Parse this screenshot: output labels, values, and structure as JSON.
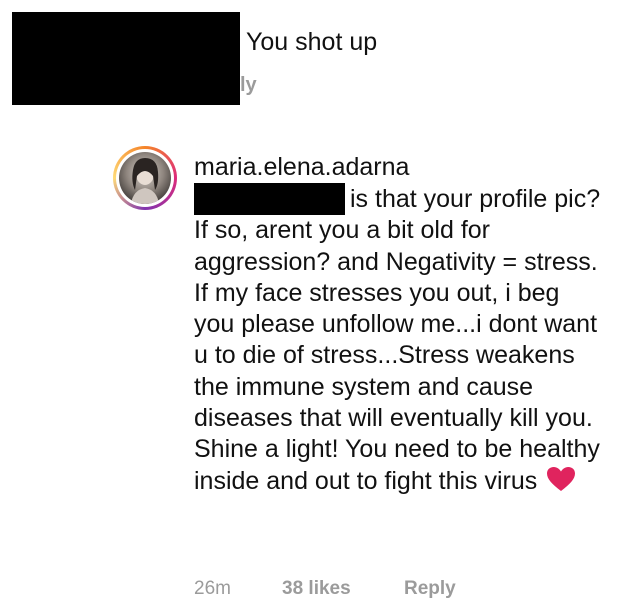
{
  "top_comment": {
    "text": "You shot up",
    "reply_fragment": "ly"
  },
  "reply_comment": {
    "username": "maria.elena.adarna",
    "body": "is that your profile pic? If so, arent you a bit old for aggression? and Negativity = stress. If my face stresses you out, i beg you please unfollow me...i dont want u to die of stress...Stress weakens the immune system and cause diseases that will eventually kill you. Shine a light! You need to be healthy inside and out to fight this virus",
    "emoji_icon": "red-heart-icon",
    "time": "26m",
    "likes": "38 likes",
    "reply_label": "Reply"
  },
  "colors": {
    "heart": "#e0245e",
    "meta_gray": "#9b9b9b"
  }
}
